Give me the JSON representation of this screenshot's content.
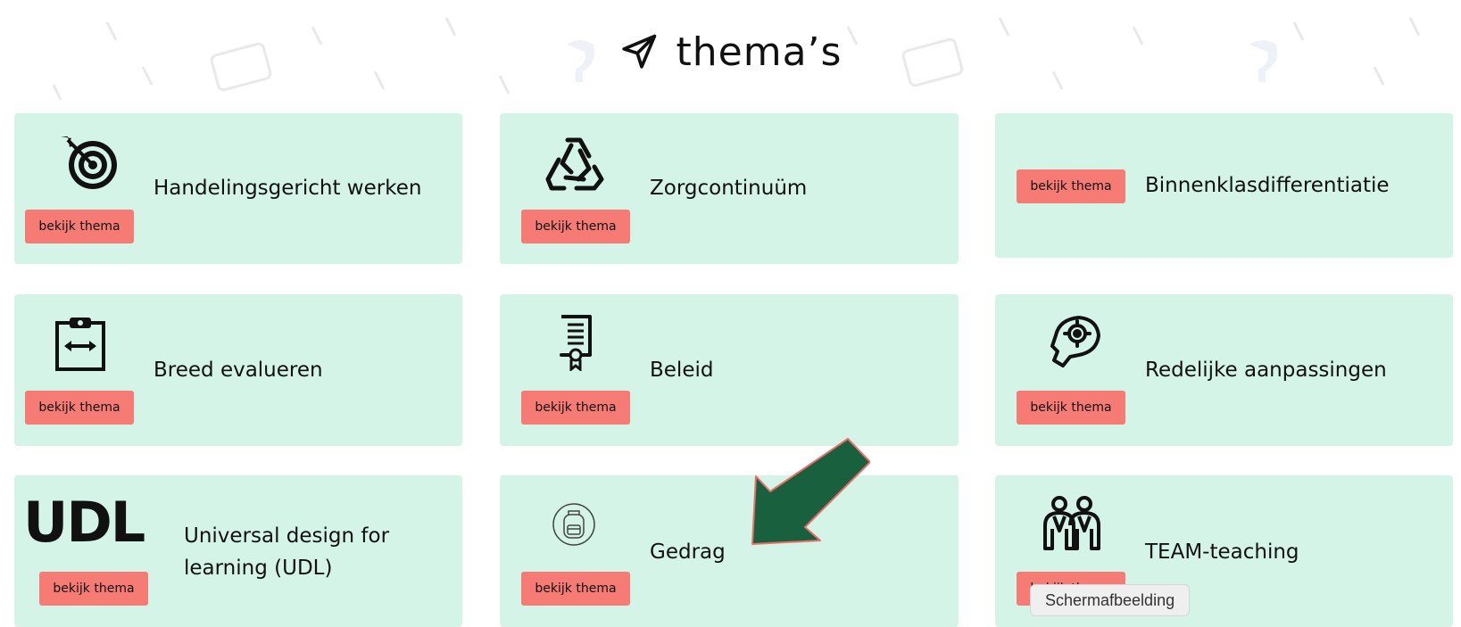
{
  "header": {
    "title": "thema’s",
    "icon": "send-icon"
  },
  "cards": [
    {
      "title": "Handelingsgericht werken",
      "button": "bekijk thema",
      "icon": "target-icon"
    },
    {
      "title": "Zorgcontinuüm",
      "button": "bekijk thema",
      "icon": "recycle-icon"
    },
    {
      "title": "Binnenklasdifferentiatie",
      "button": "bekijk thema",
      "icon": ""
    },
    {
      "title": "Breed evalueren",
      "button": "bekijk thema",
      "icon": "clipboard-icon"
    },
    {
      "title": "Beleid",
      "button": "bekijk thema",
      "icon": "certificate-icon"
    },
    {
      "title": "Redelijke aanpassingen",
      "button": "bekijk thema",
      "icon": "hand-gear-icon"
    },
    {
      "title_line1": "Universal design for",
      "title_line2": "learning (UDL)",
      "button": "bekijk thema",
      "logo_text": "UDL"
    },
    {
      "title": "Gedrag",
      "button": "bekijk thema",
      "icon": "backpack-icon"
    },
    {
      "title": "TEAM-teaching",
      "button": "bekijk thema",
      "icon": "team-icon"
    }
  ],
  "tooltip": "Schermafbeelding",
  "colors": {
    "card_bg": "#d4f4e7",
    "button_bg": "#f57b74",
    "arrow_fill": "#19603f",
    "arrow_stroke": "#e86f6a"
  }
}
